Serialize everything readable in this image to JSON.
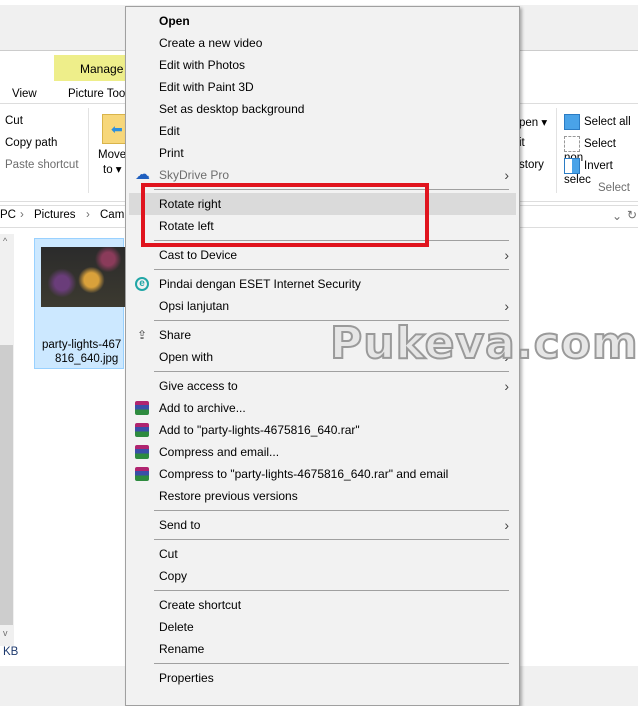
{
  "explorer": {
    "context_tab": "Manage",
    "tabs": [
      "View",
      "Picture Too"
    ],
    "clipboard": [
      "Cut",
      "Copy path",
      "Paste shortcut"
    ],
    "move_to": [
      "Move",
      "to ▾"
    ],
    "open_group": [
      "pen ▾",
      "it",
      "story"
    ],
    "select_group": {
      "items": [
        "Select all",
        "Select non",
        "Invert selec"
      ],
      "label": "Select"
    },
    "breadcrumb": [
      "PC",
      "Pictures",
      "Cam"
    ],
    "file": {
      "name_line1": "party-lights-467",
      "name_line2": "816_640.jpg"
    },
    "status": "KB"
  },
  "context_menu": [
    {
      "label": "Open",
      "bold": true
    },
    {
      "label": "Create a new video"
    },
    {
      "label": "Edit with Photos"
    },
    {
      "label": "Edit with Paint 3D"
    },
    {
      "label": "Set as desktop background"
    },
    {
      "label": "Edit"
    },
    {
      "label": "Print"
    },
    {
      "label": "SkyDrive Pro",
      "disabled": true,
      "icon": "cloud-icon",
      "submenu": true
    },
    {
      "sep": true
    },
    {
      "label": "Rotate right",
      "highlighted": true
    },
    {
      "label": "Rotate left"
    },
    {
      "sep": true
    },
    {
      "label": "Cast to Device",
      "submenu": true
    },
    {
      "sep": true
    },
    {
      "label": "Pindai dengan ESET Internet Security",
      "icon": "eset-icon"
    },
    {
      "label": "Opsi lanjutan",
      "submenu": true
    },
    {
      "sep": true
    },
    {
      "label": "Share",
      "icon": "share-icon"
    },
    {
      "label": "Open with",
      "submenu": true
    },
    {
      "sep": true
    },
    {
      "label": "Give access to",
      "submenu": true
    },
    {
      "label": "Add to archive...",
      "icon": "winrar-icon"
    },
    {
      "label": "Add to \"party-lights-4675816_640.rar\"",
      "icon": "winrar-icon"
    },
    {
      "label": "Compress and email...",
      "icon": "winrar-icon"
    },
    {
      "label": "Compress to \"party-lights-4675816_640.rar\" and email",
      "icon": "winrar-icon"
    },
    {
      "label": "Restore previous versions"
    },
    {
      "sep": true
    },
    {
      "label": "Send to",
      "submenu": true
    },
    {
      "sep": true
    },
    {
      "label": "Cut"
    },
    {
      "label": "Copy"
    },
    {
      "sep": true
    },
    {
      "label": "Create shortcut"
    },
    {
      "label": "Delete"
    },
    {
      "label": "Rename"
    },
    {
      "sep": true
    },
    {
      "label": "Properties"
    }
  ],
  "annotation": {
    "highlight_color": "#e0141e"
  },
  "watermark": "Pukeva.com"
}
